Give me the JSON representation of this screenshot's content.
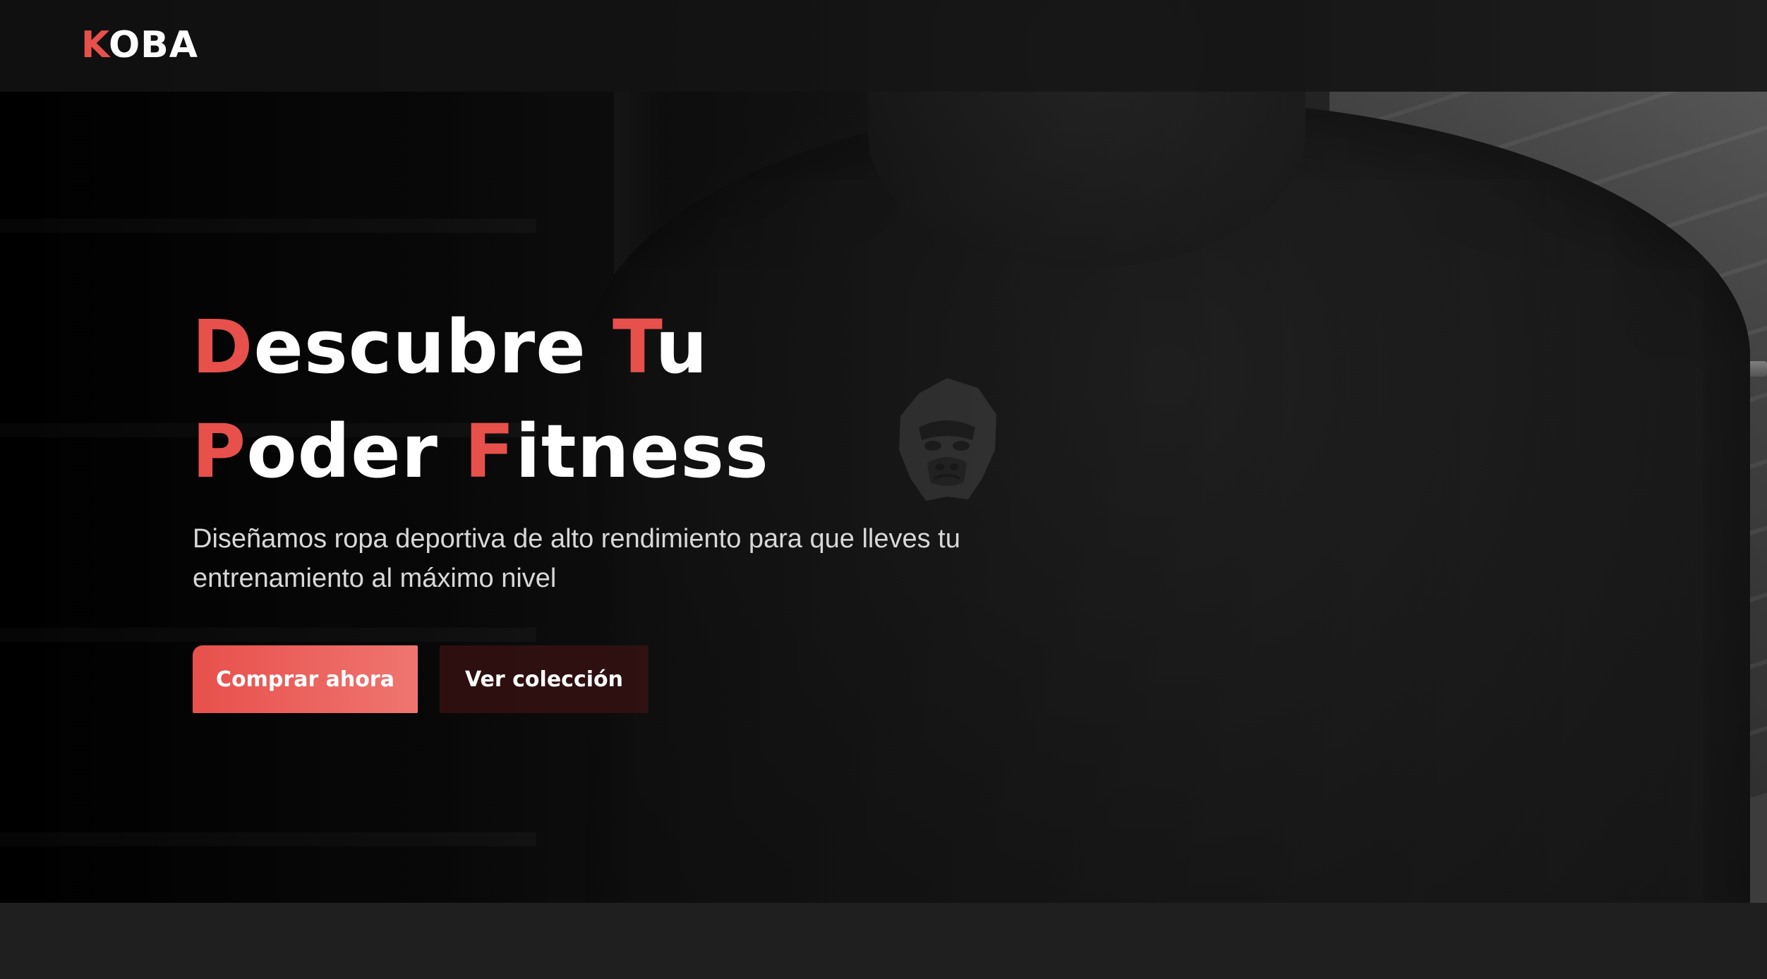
{
  "brand": {
    "first_letter": "K",
    "rest": "OBA"
  },
  "hero": {
    "title_lines": [
      [
        {
          "accent": "D",
          "rest": "escubre "
        },
        {
          "accent": "T",
          "rest": "u"
        }
      ],
      [
        {
          "accent": "P",
          "rest": "oder "
        },
        {
          "accent": "F",
          "rest": "itness"
        }
      ]
    ],
    "subtitle": "Diseñamos ropa deportiva de alto rendimiento para que lleves tu entrenamiento al máximo nivel",
    "primary_button": "Comprar ahora",
    "secondary_button": "Ver colección"
  },
  "colors": {
    "accent": "#e8504b",
    "header_bg": "#141414",
    "page_bg": "#1f1f1f",
    "secondary_button_bg": "#3c1212"
  },
  "icons": {
    "shirt_logo": "gorilla-logo-icon"
  }
}
